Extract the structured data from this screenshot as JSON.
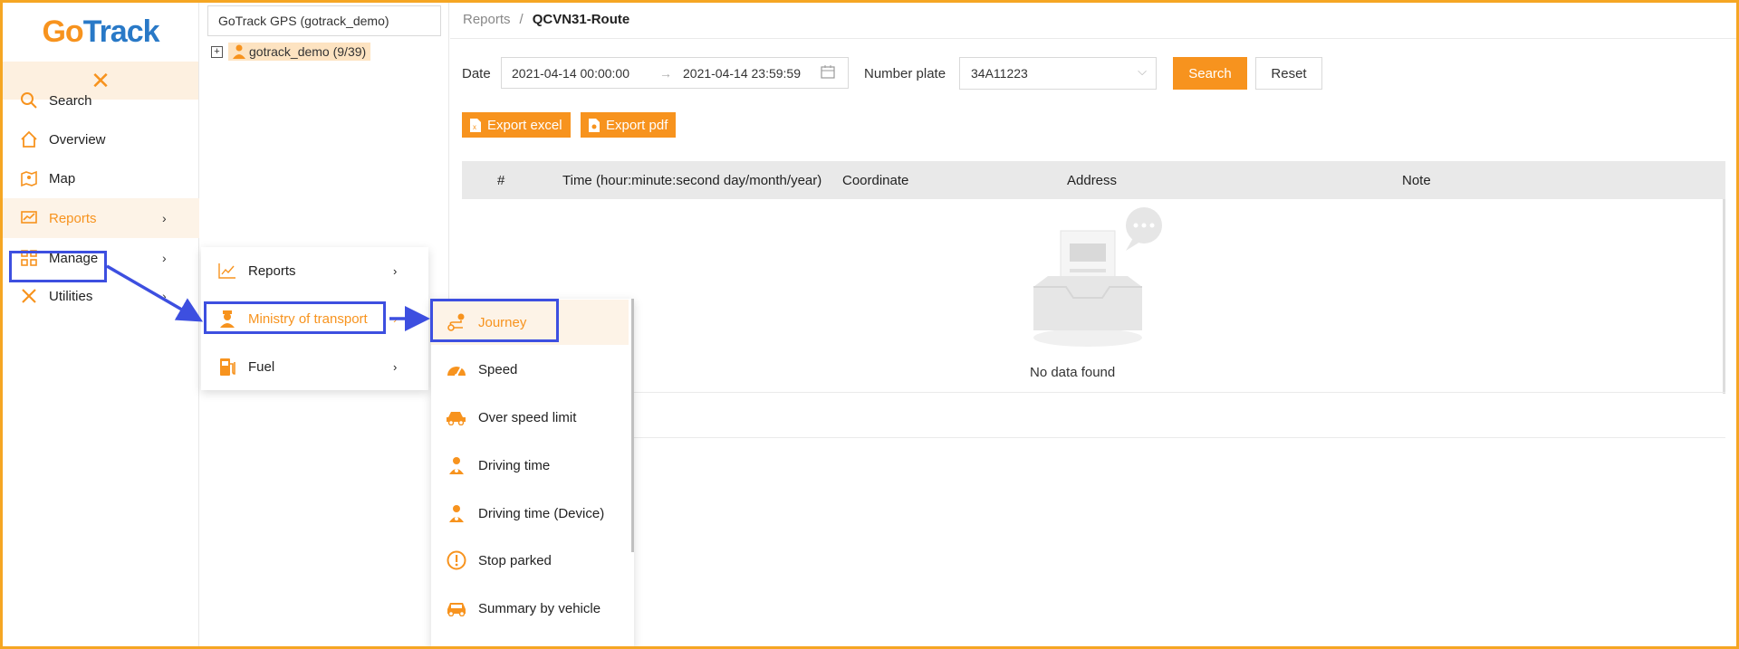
{
  "app": {
    "logo_g": "G",
    "logo_o": "o",
    "logo_rest": "Track"
  },
  "sidebar": {
    "collapse_icon": "close-icon",
    "items": [
      {
        "label": "Search",
        "icon": "search-icon"
      },
      {
        "label": "Overview",
        "icon": "home-icon"
      },
      {
        "label": "Map",
        "icon": "map-icon"
      },
      {
        "label": "Reports",
        "icon": "chart-icon",
        "arrow": "›"
      },
      {
        "label": "Manage",
        "icon": "grid-icon",
        "arrow": "›"
      },
      {
        "label": "Utilities",
        "icon": "tools-icon",
        "arrow": "›"
      }
    ]
  },
  "tree": {
    "search_value": "GoTrack GPS (gotrack_demo)",
    "expand_symbol": "+",
    "node_label": "gotrack_demo (9/39)"
  },
  "breadcrumb": {
    "parent": "Reports",
    "separator": "/",
    "current": "QCVN31-Route"
  },
  "filters": {
    "date_label": "Date",
    "date_start": "2021-04-14 00:00:00",
    "date_arrow": "→",
    "date_end": "2021-04-14 23:59:59",
    "plate_label": "Number plate",
    "plate_value": "34A11223",
    "search_label": "Search",
    "reset_label": "Reset"
  },
  "exports": {
    "excel": "Export excel",
    "pdf": "Export pdf"
  },
  "table": {
    "columns": [
      "#",
      "Time (hour:minute:second day/month/year)",
      "Coordinate",
      "Address",
      "Note"
    ],
    "empty_text": "No data found"
  },
  "popup_reports": {
    "items": [
      {
        "label": "Reports",
        "icon": "line-chart-icon",
        "arrow": "›"
      },
      {
        "label": "Ministry of transport",
        "icon": "officer-icon",
        "arrow": "›"
      },
      {
        "label": "Fuel",
        "icon": "fuel-pump-icon",
        "arrow": "›"
      }
    ]
  },
  "popup_ministry": {
    "items": [
      {
        "label": "Journey",
        "icon": "route-icon"
      },
      {
        "label": "Speed",
        "icon": "speedometer-icon"
      },
      {
        "label": "Over speed limit",
        "icon": "car-speed-icon"
      },
      {
        "label": "Driving time",
        "icon": "driver-icon"
      },
      {
        "label": "Driving time (Device)",
        "icon": "driver-icon"
      },
      {
        "label": "Stop parked",
        "icon": "warning-icon"
      },
      {
        "label": "Summary by vehicle",
        "icon": "car-icon"
      }
    ]
  },
  "colors": {
    "accent": "#f7931e",
    "highlight": "#3d4fe0",
    "logo_blue": "#2979c7"
  }
}
